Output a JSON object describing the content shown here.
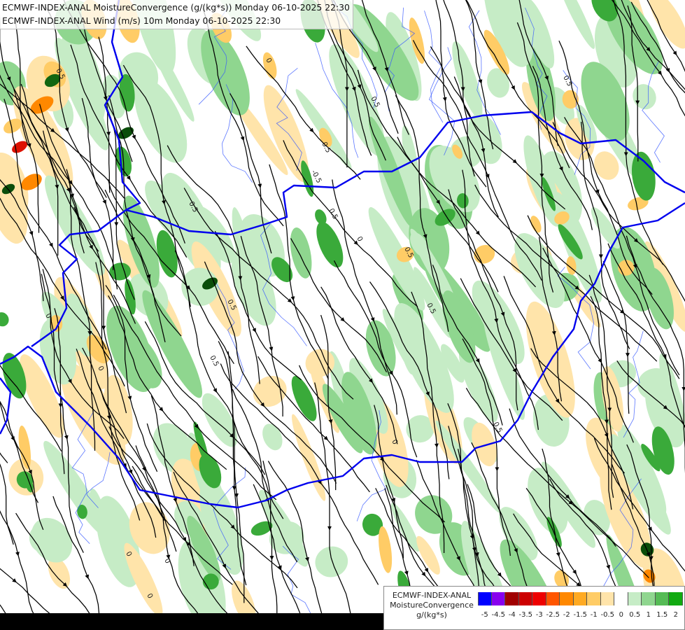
{
  "title": {
    "line1": "ECMWF-INDEX-ANAL MoistureConvergence (g/(kg*s)) Monday 06-10-2025 22:30",
    "line2": "ECMWF-INDEX-ANAL Wind (m/s) 10m Monday 06-10-2025 22:30"
  },
  "legend": {
    "line1": "ECMWF-INDEX-ANAL",
    "line2": "MoistureConvergence",
    "line3": "g/(kg*s)",
    "ticks": [
      "-5",
      "-4.5",
      "-4",
      "-3.5",
      "-3",
      "-2.5",
      "-2",
      "-1.5",
      "-1",
      "-0.5",
      "0",
      "0.5",
      "1",
      "1.5",
      "2"
    ],
    "colors": [
      "#0000ff",
      "#8800ee",
      "#a00000",
      "#cc0000",
      "#ee0000",
      "#ff5500",
      "#ff8800",
      "#ffaa22",
      "#ffcc66",
      "#ffe4aa",
      "#ffffff",
      "#c6ecc6",
      "#8fd68f",
      "#55bb55",
      "#11aa11"
    ]
  },
  "map_labels": {
    "contour_zero": "0",
    "contour_half": "0.5",
    "contour_neg_half": "-0.5"
  },
  "colors": {
    "background": "#ffffff",
    "border_blue": "#0000ee",
    "streamline": "#000000",
    "green_light": "#c6ecc6",
    "green_mid": "#8fd68f",
    "green_dark": "#3aaa3a",
    "orange_light": "#ffe4aa",
    "orange_mid": "#ffcc66",
    "orange_strong": "#ff8800",
    "red": "#dd1100"
  }
}
